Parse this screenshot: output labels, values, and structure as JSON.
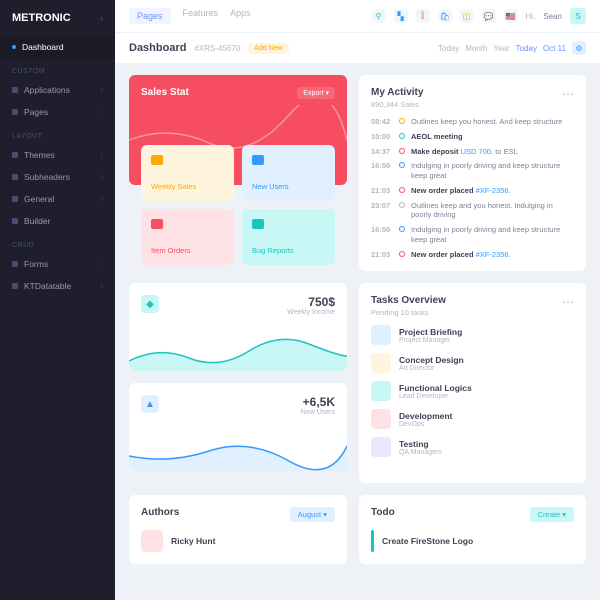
{
  "brand": "METRONIC",
  "sidebar": {
    "main": [
      {
        "label": "Dashboard",
        "active": true
      }
    ],
    "sections": [
      {
        "title": "Custom",
        "items": [
          {
            "label": "Applications"
          },
          {
            "label": "Pages"
          }
        ]
      },
      {
        "title": "Layout",
        "items": [
          {
            "label": "Themes"
          },
          {
            "label": "Subheaders"
          },
          {
            "label": "General"
          },
          {
            "label": "Builder"
          }
        ]
      },
      {
        "title": "CRUD",
        "items": [
          {
            "label": "Forms"
          },
          {
            "label": "KTDatatable"
          }
        ]
      }
    ]
  },
  "topnav": [
    {
      "label": "Pages",
      "active": true
    },
    {
      "label": "Features"
    },
    {
      "label": "Apps"
    }
  ],
  "topuser": "Sean",
  "subheader": {
    "title": "Dashboard",
    "sub": "#XRS-45670",
    "badge": "Add New",
    "tabs": [
      "Today",
      "Month",
      "Year"
    ],
    "tabs_active": "Today",
    "date": "Oct 11"
  },
  "sales": {
    "title": "Sales Stat",
    "btn": "Export",
    "tiles": [
      {
        "label": "Weekly Sales"
      },
      {
        "label": "New Users"
      },
      {
        "label": "Item Orders"
      },
      {
        "label": "Bug Reports"
      }
    ]
  },
  "activity": {
    "title": "My Activity",
    "sub": "890,344 Sales",
    "items": [
      {
        "time": "08:42",
        "color": "#ffa800",
        "text": "Outlines keep you honest. And keep structure"
      },
      {
        "time": "10:00",
        "color": "#1bc5bd",
        "bold": "AEOL meeting"
      },
      {
        "time": "14:37",
        "color": "#f64e60",
        "bold": "Make deposit ",
        "link": "USD 700",
        "after": ". to ESL"
      },
      {
        "time": "16:50",
        "color": "#3699ff",
        "text": "Indulging in poorly driving and keep structure keep great"
      },
      {
        "time": "21:03",
        "color": "#f64e60",
        "bold": "New order placed ",
        "link": "#XF-2356."
      },
      {
        "time": "23:07",
        "color": "#b5b5c3",
        "text": "Outlines keep and you honest. Indulging in poorly driving"
      },
      {
        "time": "16:50",
        "color": "#3699ff",
        "text": "Indulging in poorly driving and keep structure keep great"
      },
      {
        "time": "21:03",
        "color": "#f64e60",
        "bold": "New order placed ",
        "link": "#XF-2356."
      }
    ]
  },
  "widgets": [
    {
      "value": "750$",
      "label": "Weekly Income",
      "icon_bg": "#c9f7f5",
      "spark": "#1bc5bd"
    },
    {
      "value": "+6,5K",
      "label": "New Users",
      "icon_bg": "#e1f0ff",
      "spark": "#3699ff"
    }
  ],
  "tasks": {
    "title": "Tasks Overview",
    "sub": "Pending 10 tasks",
    "items": [
      {
        "name": "Project Briefing",
        "sub": "Project Manager",
        "color": "#e1f0ff"
      },
      {
        "name": "Concept Design",
        "sub": "Art Director",
        "color": "#fff4de"
      },
      {
        "name": "Functional Logics",
        "sub": "Lead Developer",
        "color": "#c9f7f5"
      },
      {
        "name": "Development",
        "sub": "DevOps",
        "color": "#ffe2e5"
      },
      {
        "name": "Testing",
        "sub": "QA Managers",
        "color": "#eee5ff"
      }
    ]
  },
  "authors": {
    "title": "Authors",
    "btn": "August",
    "item": {
      "name": "Ricky Hunt"
    }
  },
  "todo": {
    "title": "Todo",
    "btn": "Create",
    "item": {
      "name": "Create FireStone Logo"
    }
  }
}
